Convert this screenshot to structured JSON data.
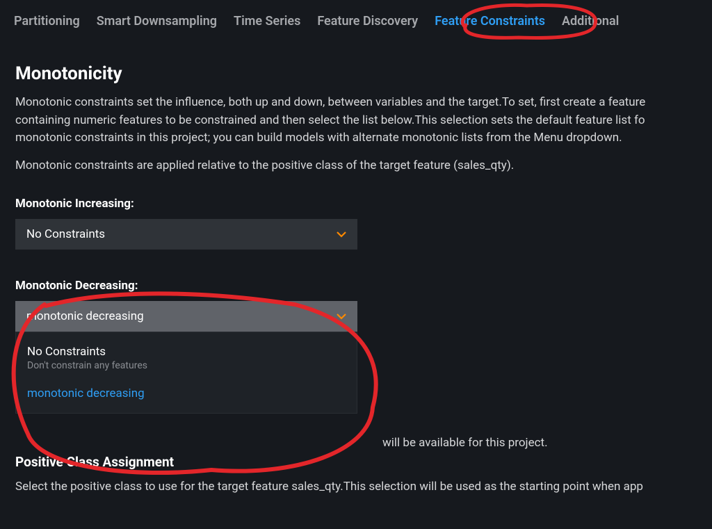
{
  "tabs": {
    "items": [
      "Partitioning",
      "Smart Downsampling",
      "Time Series",
      "Feature Discovery",
      "Feature Constraints",
      "Additional"
    ],
    "active_index": 4
  },
  "monotonicity": {
    "title": "Monotonicity",
    "p1": "Monotonic constraints set the influence, both up and down, between variables and the target.To set, first create a feature containing numeric features to be constrained and then select the list below.This selection sets the default feature list fo monotonic constraints in this project; you can build models with alternate monotonic lists from the Menu dropdown.",
    "p2": "Monotonic constraints are applied relative to the positive class of the target feature (sales_qty)."
  },
  "increasing": {
    "label": "Monotonic Increasing:",
    "selected": "No Constraints"
  },
  "decreasing": {
    "label": "Monotonic Decreasing:",
    "selected": "monotonic decreasing",
    "options": [
      {
        "title": "No Constraints",
        "sub": "Don't constrain any features"
      },
      {
        "title": "monotonic decreasing",
        "sub": ""
      }
    ]
  },
  "trailing_text": "will be available for this project.",
  "positive_class": {
    "title": "Positive Class Assignment",
    "body": "Select the positive class to use for the target feature sales_qty.This selection will be used as the starting point when app"
  },
  "colors": {
    "accent_blue": "#2f9ef4",
    "accent_orange": "#ff8a00",
    "annotation_red": "#e3262a"
  }
}
